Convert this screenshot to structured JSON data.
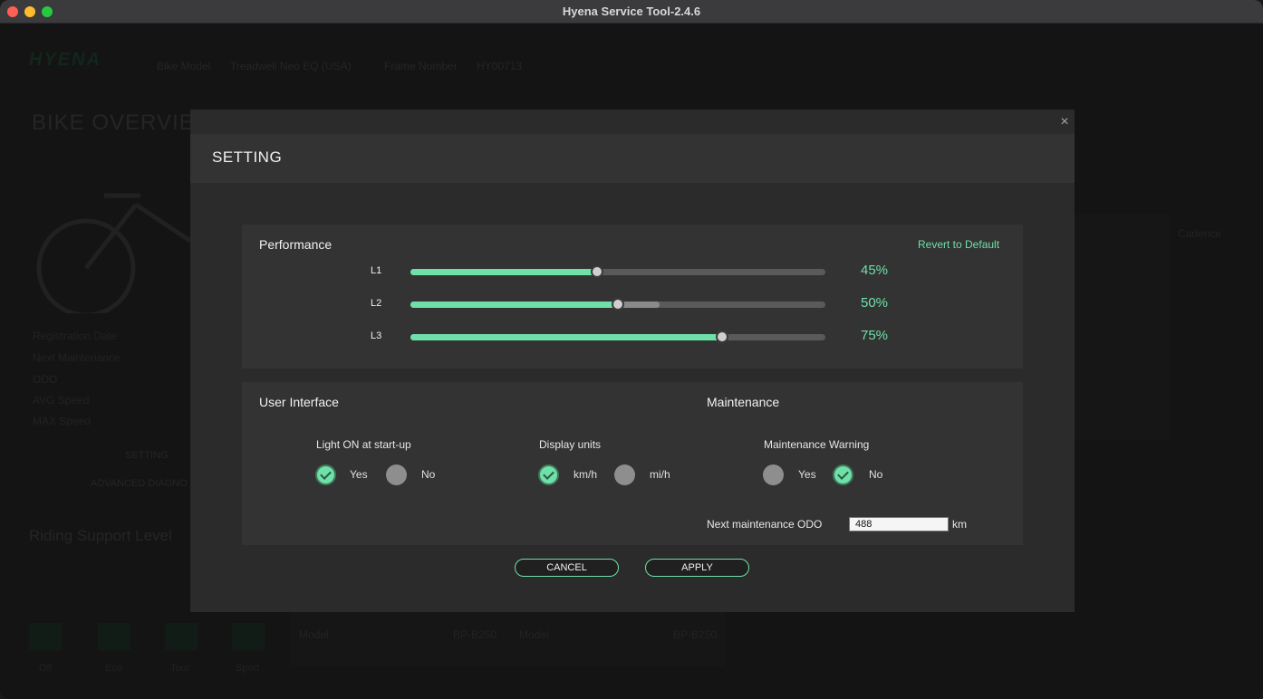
{
  "window": {
    "title": "Hyena Service Tool-2.4.6"
  },
  "background": {
    "logo": "HYENA",
    "bike_model_label": "Bike Model",
    "bike_model_value": "Treadwell Neo EQ (USA)",
    "frame_number_label": "Frame Number",
    "frame_number_value": "HY00713",
    "page_title": "BIKE OVERVIE",
    "side_labels": [
      "Registration Date",
      "Next Maintenance",
      "ODO",
      "AVG Speed",
      "MAX Speed"
    ],
    "setting_button": "SETTING",
    "advanced_button": "ADVANCED DIAGNO",
    "riding_title": "Riding Support Level",
    "cadence_label": "Cadence",
    "bottom_levels": [
      "Off",
      "Eco",
      "Tour",
      "Sport"
    ],
    "model_label": "Model",
    "model_value": "BP-B250",
    "model_value_2": "BP-B250"
  },
  "modal": {
    "title": "SETTING",
    "close_symbol": "×",
    "performance": {
      "title": "Performance",
      "revert_label": "Revert to Default",
      "sliders": [
        {
          "label": "L1",
          "value": 45,
          "display": "45%",
          "buffer": 45
        },
        {
          "label": "L2",
          "value": 50,
          "display": "50%",
          "buffer": 60
        },
        {
          "label": "L3",
          "value": 75,
          "display": "75%",
          "buffer": 75
        }
      ]
    },
    "user_interface": {
      "title": "User Interface",
      "light_on": {
        "label": "Light ON at start-up",
        "yes": "Yes",
        "no": "No",
        "selected": "yes"
      },
      "display_units": {
        "label": "Display units",
        "kmh": "km/h",
        "mih": "mi/h",
        "selected": "kmh"
      }
    },
    "maintenance": {
      "title": "Maintenance",
      "warning": {
        "label": "Maintenance Warning",
        "yes": "Yes",
        "no": "No",
        "selected": "no"
      },
      "next_odo_label": "Next maintenance ODO",
      "next_odo_value": "488",
      "unit": "km"
    },
    "buttons": {
      "cancel": "CANCEL",
      "apply": "APPLY"
    }
  },
  "colors": {
    "accent": "#6fe0a8",
    "modal_bg": "#2b2b2b",
    "section_bg": "#333333"
  }
}
